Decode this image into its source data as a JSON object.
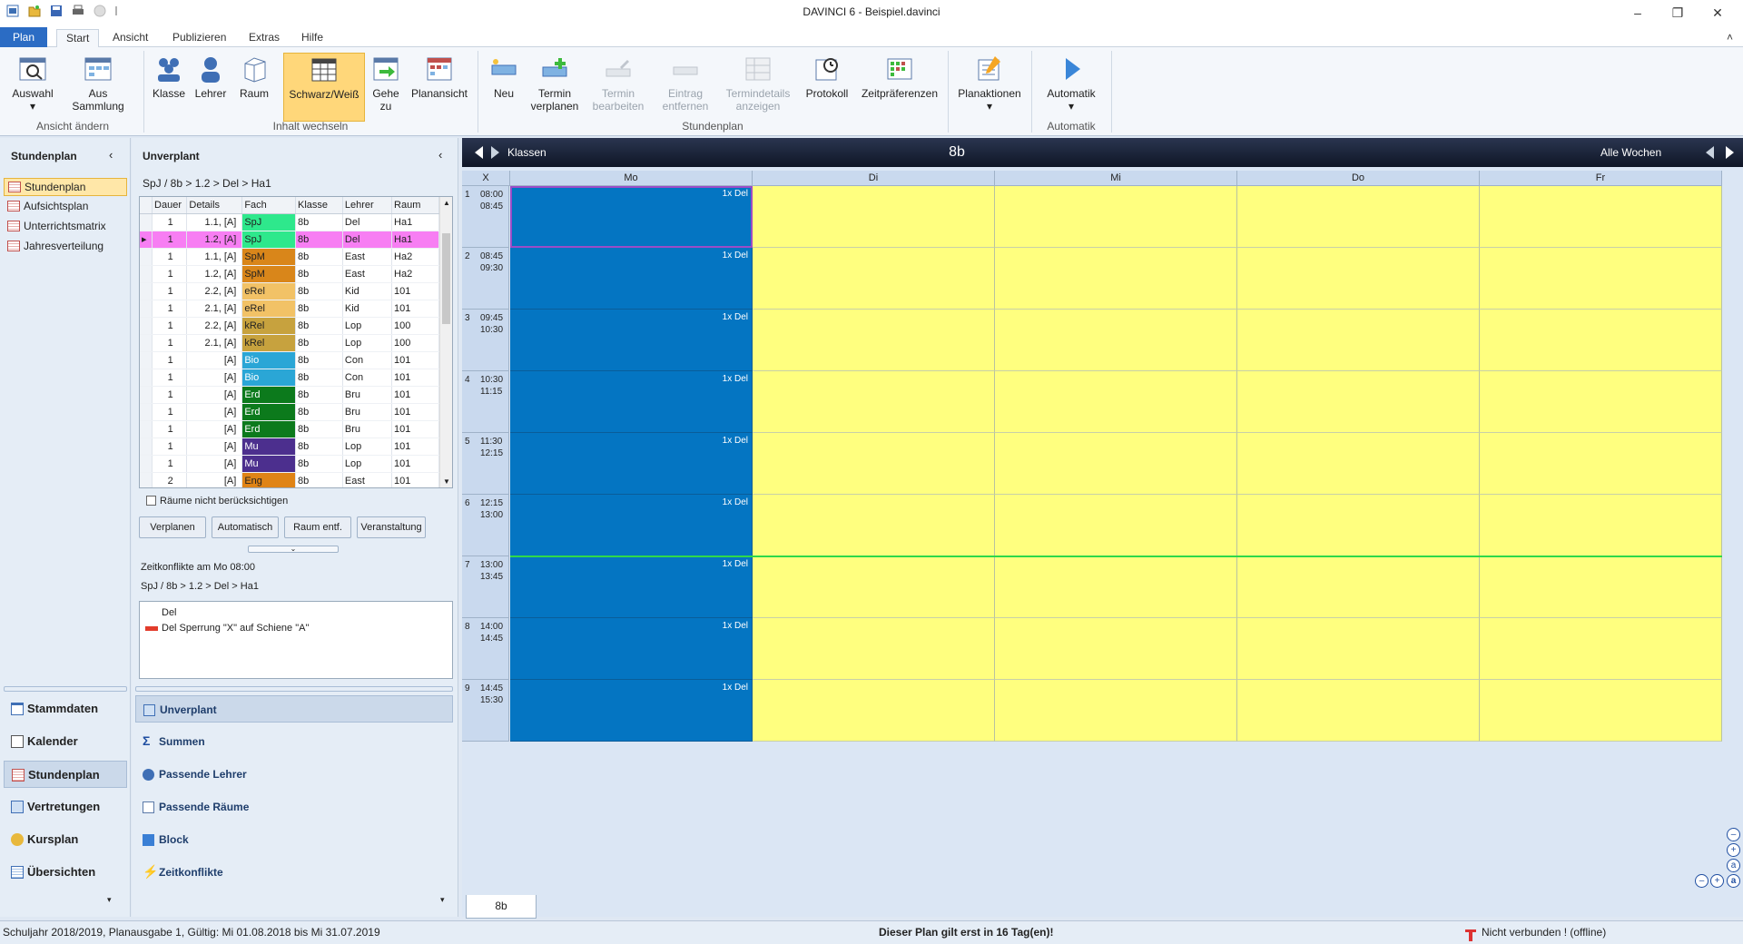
{
  "window": {
    "title": "DAVINCI 6 - Beispiel.davinci",
    "minimize": "–",
    "restore": "❐",
    "close": "✕"
  },
  "tabs": {
    "plan": "Plan",
    "items": [
      "Start",
      "Ansicht",
      "Publizieren",
      "Extras",
      "Hilfe"
    ],
    "collapse": "˄"
  },
  "ribbon": {
    "auswahl": "Auswahl",
    "aus_sammlung": "Aus Sammlung",
    "ansicht_aendern": "Ansicht ändern",
    "klasse": "Klasse",
    "lehrer": "Lehrer",
    "raum": "Raum",
    "schwarz_weiss": "Schwarz/Weiß",
    "gehe_zu": "Gehe zu",
    "planansicht": "Planansicht",
    "inhalt_wechseln": "Inhalt wechseln",
    "neu": "Neu",
    "termin_verplanen": "Termin verplanen",
    "termin_bearbeiten": "Termin bearbeiten",
    "eintrag_entfernen": "Eintrag entfernen",
    "termindetails_anzeigen": "Termindetails anzeigen",
    "protokoll": "Protokoll",
    "zeitpraeferenzen": "Zeitpräferenzen",
    "stundenplan_group": "Stundenplan",
    "planaktionen": "Planaktionen",
    "automatik": "Automatik",
    "automatik_group": "Automatik"
  },
  "leftnav": {
    "header": "Stundenplan",
    "items": [
      "Stundenplan",
      "Aufsichtsplan",
      "Unterrichtsmatrix",
      "Jahresverteilung"
    ],
    "modules": [
      "Stammdaten",
      "Kalender",
      "Stundenplan",
      "Vertretungen",
      "Kursplan",
      "Übersichten"
    ]
  },
  "unverplant": {
    "header": "Unverplant",
    "breadcrumb": "SpJ / 8b > 1.2 > Del > Ha1",
    "columns": [
      "Dauer",
      "Details",
      "Fach",
      "Klasse",
      "Lehrer",
      "Raum"
    ],
    "rows": [
      {
        "dauer": "1",
        "details": "1.1, [A]",
        "fach": "SpJ",
        "klasse": "8b",
        "lehrer": "Del",
        "raum": "Ha1",
        "color": "#2ee88c"
      },
      {
        "dauer": "1",
        "details": "1.2, [A]",
        "fach": "SpJ",
        "klasse": "8b",
        "lehrer": "Del",
        "raum": "Ha1",
        "color": "#2ee88c"
      },
      {
        "dauer": "1",
        "details": "1.1, [A]",
        "fach": "SpM",
        "klasse": "8b",
        "lehrer": "East",
        "raum": "Ha2",
        "color": "#d9861a"
      },
      {
        "dauer": "1",
        "details": "1.2, [A]",
        "fach": "SpM",
        "klasse": "8b",
        "lehrer": "East",
        "raum": "Ha2",
        "color": "#d9861a"
      },
      {
        "dauer": "1",
        "details": "2.2, [A]",
        "fach": "eRel",
        "klasse": "8b",
        "lehrer": "Kid",
        "raum": "101",
        "color": "#f2c266"
      },
      {
        "dauer": "1",
        "details": "2.1, [A]",
        "fach": "eRel",
        "klasse": "8b",
        "lehrer": "Kid",
        "raum": "101",
        "color": "#f2c266"
      },
      {
        "dauer": "1",
        "details": "2.2, [A]",
        "fach": "kRel",
        "klasse": "8b",
        "lehrer": "Lop",
        "raum": "100",
        "color": "#c7a23e"
      },
      {
        "dauer": "1",
        "details": "2.1, [A]",
        "fach": "kRel",
        "klasse": "8b",
        "lehrer": "Lop",
        "raum": "100",
        "color": "#c7a23e"
      },
      {
        "dauer": "1",
        "details": "[A]",
        "fach": "Bio",
        "klasse": "8b",
        "lehrer": "Con",
        "raum": "101",
        "color": "#2aa6d6"
      },
      {
        "dauer": "1",
        "details": "[A]",
        "fach": "Bio",
        "klasse": "8b",
        "lehrer": "Con",
        "raum": "101",
        "color": "#2aa6d6"
      },
      {
        "dauer": "1",
        "details": "[A]",
        "fach": "Erd",
        "klasse": "8b",
        "lehrer": "Bru",
        "raum": "101",
        "color": "#0c7a1c"
      },
      {
        "dauer": "1",
        "details": "[A]",
        "fach": "Erd",
        "klasse": "8b",
        "lehrer": "Bru",
        "raum": "101",
        "color": "#0c7a1c"
      },
      {
        "dauer": "1",
        "details": "[A]",
        "fach": "Erd",
        "klasse": "8b",
        "lehrer": "Bru",
        "raum": "101",
        "color": "#0c7a1c"
      },
      {
        "dauer": "1",
        "details": "[A]",
        "fach": "Mu",
        "klasse": "8b",
        "lehrer": "Lop",
        "raum": "101",
        "color": "#4c2f8e"
      },
      {
        "dauer": "1",
        "details": "[A]",
        "fach": "Mu",
        "klasse": "8b",
        "lehrer": "Lop",
        "raum": "101",
        "color": "#4c2f8e"
      },
      {
        "dauer": "2",
        "details": "[A]",
        "fach": "Eng",
        "klasse": "8b",
        "lehrer": "East",
        "raum": "101",
        "color": "#e08416"
      }
    ],
    "checkbox": "Räume nicht berücksichtigen",
    "buttons": [
      "Verplanen",
      "Automatisch",
      "Raum entf.",
      "Veranstaltung"
    ],
    "conflict_title": "Zeitkonflikte am Mo 08:00",
    "conflict_path": "SpJ / 8b > 1.2 > Del > Ha1",
    "conflicts": [
      "Del",
      "Del Sperrung \"X\" auf Schiene \"A\""
    ],
    "side_items": [
      "Unverplant",
      "Summen",
      "Passende Lehrer",
      "Passende Räume",
      "Block",
      "Zeitkonflikte"
    ]
  },
  "timetable": {
    "bar_left": "Klassen",
    "bar_center": "8b",
    "bar_right": "Alle Wochen",
    "corner": "X",
    "days": [
      "Mo",
      "Di",
      "Mi",
      "Do",
      "Fr"
    ],
    "slots": [
      {
        "n": "1",
        "from": "08:00",
        "to": "08:45"
      },
      {
        "n": "2",
        "from": "08:45",
        "to": "09:30"
      },
      {
        "n": "3",
        "from": "09:45",
        "to": "10:30"
      },
      {
        "n": "4",
        "from": "10:30",
        "to": "11:15"
      },
      {
        "n": "5",
        "from": "11:30",
        "to": "12:15"
      },
      {
        "n": "6",
        "from": "12:15",
        "to": "13:00"
      },
      {
        "n": "7",
        "from": "13:00",
        "to": "13:45"
      },
      {
        "n": "8",
        "from": "14:00",
        "to": "14:45"
      },
      {
        "n": "9",
        "from": "14:45",
        "to": "15:30"
      }
    ],
    "cell_label": "1x Del",
    "colors": {
      "available": "#0475c2",
      "blocked": "#ffff7f"
    },
    "bottom_tab": "8b"
  },
  "status": {
    "left": "Schuljahr 2018/2019, Planausgabe 1, Gültig: Mi 01.08.2018 bis Mi 31.07.2019",
    "center": "Dieser Plan gilt erst in 16 Tag(en)!",
    "right": "Nicht verbunden ! (offline)"
  }
}
